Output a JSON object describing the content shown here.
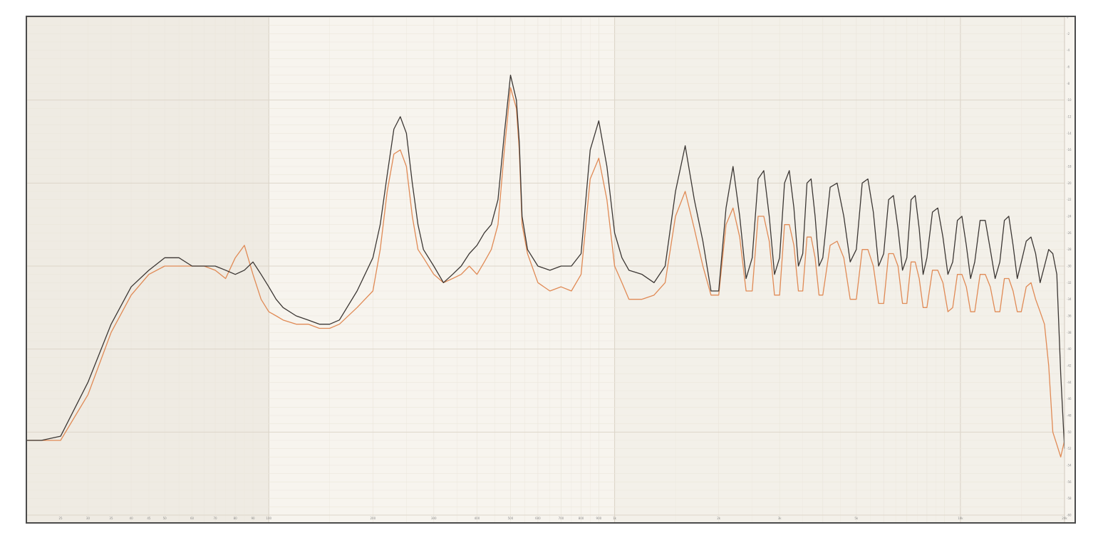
{
  "chart_data": {
    "type": "line",
    "title": "",
    "xlabel": "",
    "ylabel": "",
    "x_scale": "log",
    "xlim": [
      20,
      20000
    ],
    "ylim": [
      -60,
      0
    ],
    "grid": true,
    "legend": "none",
    "colors": {
      "background": "#f7f4ee",
      "band": "#efebe3",
      "grid_minor": "#ebe6dc",
      "grid_major": "#ddd6ca",
      "frame": "#4b4b4b"
    },
    "series": [
      {
        "color": "#3b3633",
        "x": [
          20,
          22,
          25,
          30,
          35,
          40,
          45,
          50,
          55,
          60,
          65,
          70,
          75,
          80,
          85,
          90,
          95,
          100,
          105,
          110,
          120,
          130,
          140,
          150,
          160,
          180,
          200,
          210,
          220,
          230,
          240,
          250,
          260,
          270,
          280,
          300,
          320,
          340,
          360,
          380,
          400,
          420,
          440,
          460,
          480,
          500,
          520,
          530,
          540,
          560,
          600,
          650,
          700,
          750,
          800,
          850,
          900,
          950,
          1000,
          1050,
          1100,
          1200,
          1300,
          1400,
          1500,
          1600,
          1700,
          1800,
          1900,
          2000,
          2100,
          2200,
          2300,
          2400,
          2500,
          2600,
          2700,
          2800,
          2900,
          3000,
          3100,
          3200,
          3300,
          3400,
          3500,
          3600,
          3700,
          3800,
          3900,
          4000,
          4200,
          4400,
          4600,
          4800,
          5000,
          5200,
          5400,
          5600,
          5800,
          6000,
          6200,
          6400,
          6600,
          6800,
          7000,
          7200,
          7400,
          7600,
          7800,
          8000,
          8300,
          8600,
          8900,
          9200,
          9500,
          9800,
          10100,
          10400,
          10700,
          11000,
          11400,
          11800,
          12200,
          12600,
          13000,
          13400,
          13800,
          14200,
          14600,
          15000,
          15500,
          16000,
          16500,
          17000,
          17500,
          18000,
          18500,
          19000,
          19500,
          20000
        ],
        "y": [
          -51.0,
          -51.0,
          -50.5,
          -44.0,
          -37.0,
          -32.5,
          -30.5,
          -29.0,
          -29.0,
          -30.0,
          -30.0,
          -30.0,
          -30.5,
          -31.0,
          -30.5,
          -29.5,
          -31.0,
          -32.5,
          -34.0,
          -35.0,
          -36.0,
          -36.5,
          -37.0,
          -37.0,
          -36.5,
          -33.0,
          -29.0,
          -25.0,
          -19.0,
          -13.5,
          -12.0,
          -14.0,
          -20.0,
          -25.0,
          -28.0,
          -30.0,
          -32.0,
          -31.0,
          -30.0,
          -28.5,
          -27.5,
          -26.0,
          -25.0,
          -22.0,
          -14.0,
          -7.0,
          -10.0,
          -15.0,
          -24.0,
          -28.0,
          -30.0,
          -30.5,
          -30.0,
          -30.0,
          -28.5,
          -16.0,
          -12.5,
          -18.0,
          -26.0,
          -29.0,
          -30.5,
          -31.0,
          -32.0,
          -30.0,
          -21.0,
          -15.5,
          -22.0,
          -27.0,
          -33.0,
          -33.0,
          -23.0,
          -18.0,
          -24.0,
          -31.5,
          -29.0,
          -19.5,
          -18.5,
          -24.0,
          -31.0,
          -29.0,
          -20.0,
          -18.5,
          -23.0,
          -30.0,
          -28.5,
          -20.0,
          -19.5,
          -24.0,
          -30.0,
          -29.0,
          -20.5,
          -20.0,
          -24.0,
          -29.5,
          -28.0,
          -20.0,
          -19.5,
          -23.5,
          -30.0,
          -28.5,
          -22.0,
          -21.5,
          -25.5,
          -30.5,
          -29.0,
          -22.0,
          -21.5,
          -25.5,
          -31.0,
          -29.0,
          -23.5,
          -23.0,
          -26.5,
          -31.0,
          -29.5,
          -24.5,
          -24.0,
          -27.5,
          -31.5,
          -29.5,
          -24.5,
          -24.5,
          -28.0,
          -31.5,
          -29.5,
          -24.5,
          -24.0,
          -27.5,
          -31.5,
          -29.5,
          -27.0,
          -26.5,
          -28.5,
          -32.0,
          -30.0,
          -28.0,
          -28.5,
          -31.0,
          -43.0,
          -52.0
        ]
      },
      {
        "color": "#e08a55",
        "x": [
          20,
          22,
          25,
          30,
          35,
          40,
          45,
          50,
          55,
          60,
          65,
          70,
          75,
          80,
          85,
          90,
          95,
          100,
          105,
          110,
          120,
          130,
          140,
          150,
          160,
          180,
          200,
          210,
          220,
          230,
          240,
          250,
          260,
          270,
          280,
          300,
          320,
          340,
          360,
          380,
          400,
          420,
          440,
          460,
          480,
          500,
          520,
          530,
          540,
          560,
          600,
          650,
          700,
          750,
          800,
          850,
          900,
          950,
          1000,
          1050,
          1100,
          1200,
          1300,
          1400,
          1500,
          1600,
          1700,
          1800,
          1900,
          2000,
          2100,
          2200,
          2300,
          2400,
          2500,
          2600,
          2700,
          2800,
          2900,
          3000,
          3100,
          3200,
          3300,
          3400,
          3500,
          3600,
          3700,
          3800,
          3900,
          4000,
          4200,
          4400,
          4600,
          4800,
          5000,
          5200,
          5400,
          5600,
          5800,
          6000,
          6200,
          6400,
          6600,
          6800,
          7000,
          7200,
          7400,
          7600,
          7800,
          8000,
          8300,
          8600,
          8900,
          9200,
          9500,
          9800,
          10100,
          10400,
          10700,
          11000,
          11400,
          11800,
          12200,
          12600,
          13000,
          13400,
          13800,
          14200,
          14600,
          15000,
          15500,
          16000,
          16500,
          17000,
          17500,
          18000,
          18500,
          19000,
          19500,
          20000
        ],
        "y": [
          -51.0,
          -51.0,
          -51.0,
          -45.5,
          -38.0,
          -33.5,
          -31.0,
          -30.0,
          -30.0,
          -30.0,
          -30.0,
          -30.5,
          -31.5,
          -29.0,
          -27.5,
          -31.0,
          -34.0,
          -35.5,
          -36.0,
          -36.5,
          -37.0,
          -37.0,
          -37.5,
          -37.5,
          -37.0,
          -35.0,
          -33.0,
          -28.0,
          -21.0,
          -16.5,
          -16.0,
          -18.0,
          -24.0,
          -28.0,
          -29.0,
          -31.0,
          -32.0,
          -31.5,
          -31.0,
          -30.0,
          -31.0,
          -29.5,
          -28.0,
          -25.0,
          -16.0,
          -8.5,
          -11.0,
          -16.0,
          -25.0,
          -28.5,
          -32.0,
          -33.0,
          -32.5,
          -33.0,
          -31.0,
          -19.5,
          -17.0,
          -22.0,
          -30.0,
          -32.0,
          -34.0,
          -34.0,
          -33.5,
          -32.0,
          -24.0,
          -21.0,
          -25.5,
          -30.0,
          -33.5,
          -33.5,
          -25.0,
          -23.0,
          -26.5,
          -33.0,
          -33.0,
          -24.0,
          -24.0,
          -27.0,
          -33.5,
          -33.5,
          -25.0,
          -25.0,
          -27.5,
          -33.0,
          -33.0,
          -26.5,
          -26.5,
          -29.0,
          -33.5,
          -33.5,
          -27.5,
          -27.0,
          -29.0,
          -34.0,
          -34.0,
          -28.0,
          -28.0,
          -30.0,
          -34.5,
          -34.5,
          -28.5,
          -28.5,
          -30.0,
          -34.5,
          -34.5,
          -29.5,
          -29.5,
          -31.5,
          -35.0,
          -35.0,
          -30.5,
          -30.5,
          -32.0,
          -35.5,
          -35.0,
          -31.0,
          -31.0,
          -32.5,
          -35.5,
          -35.5,
          -31.0,
          -31.0,
          -32.5,
          -35.5,
          -35.5,
          -31.5,
          -31.5,
          -33.0,
          -35.5,
          -35.5,
          -32.5,
          -32.0,
          -34.0,
          -35.5,
          -37.0,
          -42.0,
          -50.0,
          -51.5,
          -53.0,
          -51.0
        ]
      }
    ],
    "x_ticks": [
      {
        "v": 25,
        "label": "25"
      },
      {
        "v": 30,
        "label": "30"
      },
      {
        "v": 35,
        "label": "35"
      },
      {
        "v": 40,
        "label": "40"
      },
      {
        "v": 45,
        "label": "45"
      },
      {
        "v": 50,
        "label": "50"
      },
      {
        "v": 60,
        "label": "60"
      },
      {
        "v": 70,
        "label": "70"
      },
      {
        "v": 80,
        "label": "80"
      },
      {
        "v": 90,
        "label": "90"
      },
      {
        "v": 100,
        "label": "100"
      },
      {
        "v": 200,
        "label": "200"
      },
      {
        "v": 300,
        "label": "300"
      },
      {
        "v": 400,
        "label": "400"
      },
      {
        "v": 500,
        "label": "500"
      },
      {
        "v": 600,
        "label": "600"
      },
      {
        "v": 700,
        "label": "700"
      },
      {
        "v": 800,
        "label": "800"
      },
      {
        "v": 900,
        "label": "900"
      },
      {
        "v": 1000,
        "label": "1k"
      },
      {
        "v": 2000,
        "label": "2k"
      },
      {
        "v": 3000,
        "label": "3k"
      },
      {
        "v": 5000,
        "label": "5k"
      },
      {
        "v": 10000,
        "label": "10k"
      },
      {
        "v": 20000,
        "label": "20k"
      }
    ],
    "y_ticks": [
      {
        "v": 0,
        "label": "0"
      },
      {
        "v": -2,
        "label": "-2"
      },
      {
        "v": -4,
        "label": "-4"
      },
      {
        "v": -6,
        "label": "-6"
      },
      {
        "v": -8,
        "label": "-8"
      },
      {
        "v": -10,
        "label": "-10"
      },
      {
        "v": -12,
        "label": "-12"
      },
      {
        "v": -14,
        "label": "-14"
      },
      {
        "v": -16,
        "label": "-16"
      },
      {
        "v": -18,
        "label": "-18"
      },
      {
        "v": -20,
        "label": "-20"
      },
      {
        "v": -22,
        "label": "-22"
      },
      {
        "v": -24,
        "label": "-24"
      },
      {
        "v": -26,
        "label": "-26"
      },
      {
        "v": -28,
        "label": "-28"
      },
      {
        "v": -30,
        "label": "-30"
      },
      {
        "v": -32,
        "label": "-32"
      },
      {
        "v": -34,
        "label": "-34"
      },
      {
        "v": -36,
        "label": "-36"
      },
      {
        "v": -38,
        "label": "-38"
      },
      {
        "v": -40,
        "label": "-40"
      },
      {
        "v": -42,
        "label": "-42"
      },
      {
        "v": -44,
        "label": "-44"
      },
      {
        "v": -46,
        "label": "-46"
      },
      {
        "v": -48,
        "label": "-48"
      },
      {
        "v": -50,
        "label": "-50"
      },
      {
        "v": -52,
        "label": "-52"
      },
      {
        "v": -54,
        "label": "-54"
      },
      {
        "v": -56,
        "label": "-56"
      },
      {
        "v": -58,
        "label": "-58"
      },
      {
        "v": -60,
        "label": "-60"
      }
    ]
  }
}
